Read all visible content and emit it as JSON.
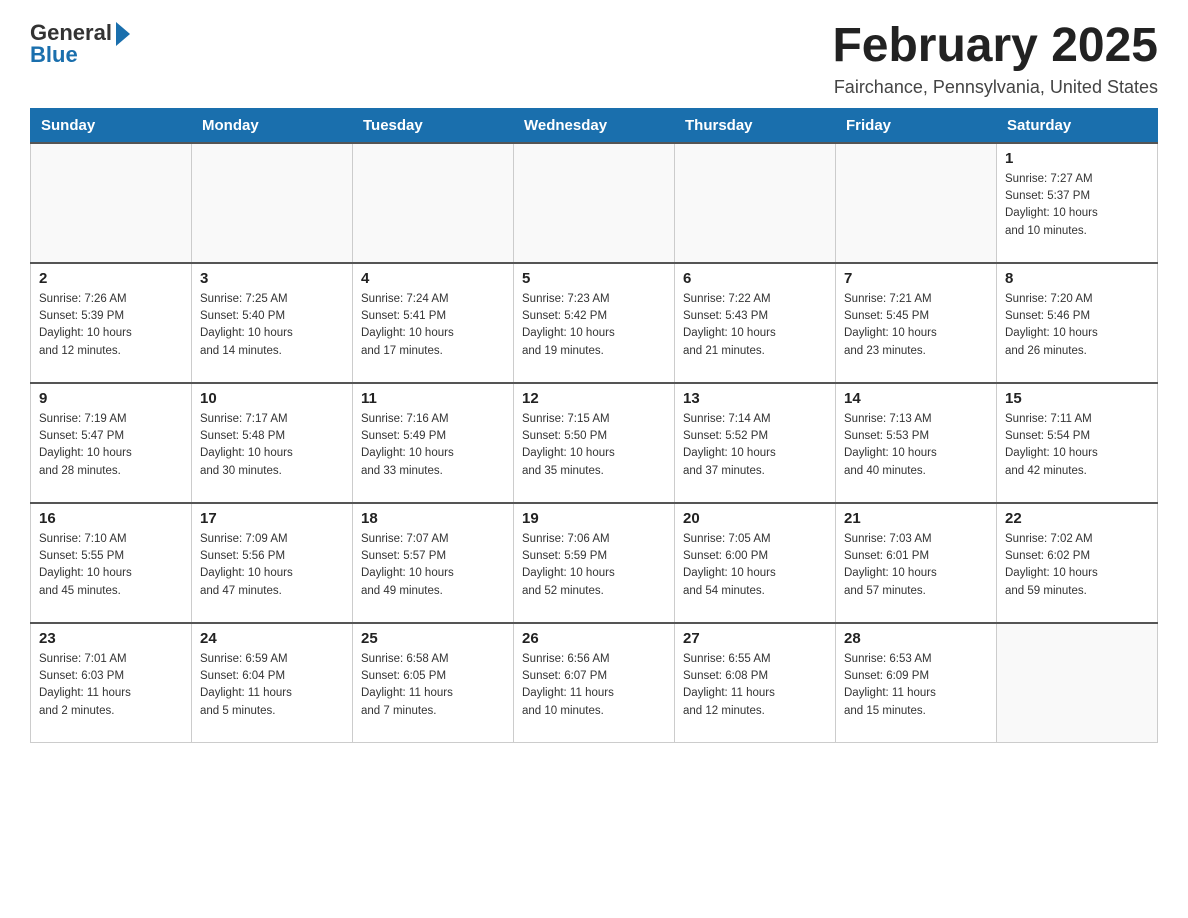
{
  "logo": {
    "general": "General",
    "blue": "Blue"
  },
  "title": "February 2025",
  "location": "Fairchance, Pennsylvania, United States",
  "days_of_week": [
    "Sunday",
    "Monday",
    "Tuesday",
    "Wednesday",
    "Thursday",
    "Friday",
    "Saturday"
  ],
  "weeks": [
    [
      {
        "day": "",
        "info": ""
      },
      {
        "day": "",
        "info": ""
      },
      {
        "day": "",
        "info": ""
      },
      {
        "day": "",
        "info": ""
      },
      {
        "day": "",
        "info": ""
      },
      {
        "day": "",
        "info": ""
      },
      {
        "day": "1",
        "info": "Sunrise: 7:27 AM\nSunset: 5:37 PM\nDaylight: 10 hours\nand 10 minutes."
      }
    ],
    [
      {
        "day": "2",
        "info": "Sunrise: 7:26 AM\nSunset: 5:39 PM\nDaylight: 10 hours\nand 12 minutes."
      },
      {
        "day": "3",
        "info": "Sunrise: 7:25 AM\nSunset: 5:40 PM\nDaylight: 10 hours\nand 14 minutes."
      },
      {
        "day": "4",
        "info": "Sunrise: 7:24 AM\nSunset: 5:41 PM\nDaylight: 10 hours\nand 17 minutes."
      },
      {
        "day": "5",
        "info": "Sunrise: 7:23 AM\nSunset: 5:42 PM\nDaylight: 10 hours\nand 19 minutes."
      },
      {
        "day": "6",
        "info": "Sunrise: 7:22 AM\nSunset: 5:43 PM\nDaylight: 10 hours\nand 21 minutes."
      },
      {
        "day": "7",
        "info": "Sunrise: 7:21 AM\nSunset: 5:45 PM\nDaylight: 10 hours\nand 23 minutes."
      },
      {
        "day": "8",
        "info": "Sunrise: 7:20 AM\nSunset: 5:46 PM\nDaylight: 10 hours\nand 26 minutes."
      }
    ],
    [
      {
        "day": "9",
        "info": "Sunrise: 7:19 AM\nSunset: 5:47 PM\nDaylight: 10 hours\nand 28 minutes."
      },
      {
        "day": "10",
        "info": "Sunrise: 7:17 AM\nSunset: 5:48 PM\nDaylight: 10 hours\nand 30 minutes."
      },
      {
        "day": "11",
        "info": "Sunrise: 7:16 AM\nSunset: 5:49 PM\nDaylight: 10 hours\nand 33 minutes."
      },
      {
        "day": "12",
        "info": "Sunrise: 7:15 AM\nSunset: 5:50 PM\nDaylight: 10 hours\nand 35 minutes."
      },
      {
        "day": "13",
        "info": "Sunrise: 7:14 AM\nSunset: 5:52 PM\nDaylight: 10 hours\nand 37 minutes."
      },
      {
        "day": "14",
        "info": "Sunrise: 7:13 AM\nSunset: 5:53 PM\nDaylight: 10 hours\nand 40 minutes."
      },
      {
        "day": "15",
        "info": "Sunrise: 7:11 AM\nSunset: 5:54 PM\nDaylight: 10 hours\nand 42 minutes."
      }
    ],
    [
      {
        "day": "16",
        "info": "Sunrise: 7:10 AM\nSunset: 5:55 PM\nDaylight: 10 hours\nand 45 minutes."
      },
      {
        "day": "17",
        "info": "Sunrise: 7:09 AM\nSunset: 5:56 PM\nDaylight: 10 hours\nand 47 minutes."
      },
      {
        "day": "18",
        "info": "Sunrise: 7:07 AM\nSunset: 5:57 PM\nDaylight: 10 hours\nand 49 minutes."
      },
      {
        "day": "19",
        "info": "Sunrise: 7:06 AM\nSunset: 5:59 PM\nDaylight: 10 hours\nand 52 minutes."
      },
      {
        "day": "20",
        "info": "Sunrise: 7:05 AM\nSunset: 6:00 PM\nDaylight: 10 hours\nand 54 minutes."
      },
      {
        "day": "21",
        "info": "Sunrise: 7:03 AM\nSunset: 6:01 PM\nDaylight: 10 hours\nand 57 minutes."
      },
      {
        "day": "22",
        "info": "Sunrise: 7:02 AM\nSunset: 6:02 PM\nDaylight: 10 hours\nand 59 minutes."
      }
    ],
    [
      {
        "day": "23",
        "info": "Sunrise: 7:01 AM\nSunset: 6:03 PM\nDaylight: 11 hours\nand 2 minutes."
      },
      {
        "day": "24",
        "info": "Sunrise: 6:59 AM\nSunset: 6:04 PM\nDaylight: 11 hours\nand 5 minutes."
      },
      {
        "day": "25",
        "info": "Sunrise: 6:58 AM\nSunset: 6:05 PM\nDaylight: 11 hours\nand 7 minutes."
      },
      {
        "day": "26",
        "info": "Sunrise: 6:56 AM\nSunset: 6:07 PM\nDaylight: 11 hours\nand 10 minutes."
      },
      {
        "day": "27",
        "info": "Sunrise: 6:55 AM\nSunset: 6:08 PM\nDaylight: 11 hours\nand 12 minutes."
      },
      {
        "day": "28",
        "info": "Sunrise: 6:53 AM\nSunset: 6:09 PM\nDaylight: 11 hours\nand 15 minutes."
      },
      {
        "day": "",
        "info": ""
      }
    ]
  ]
}
